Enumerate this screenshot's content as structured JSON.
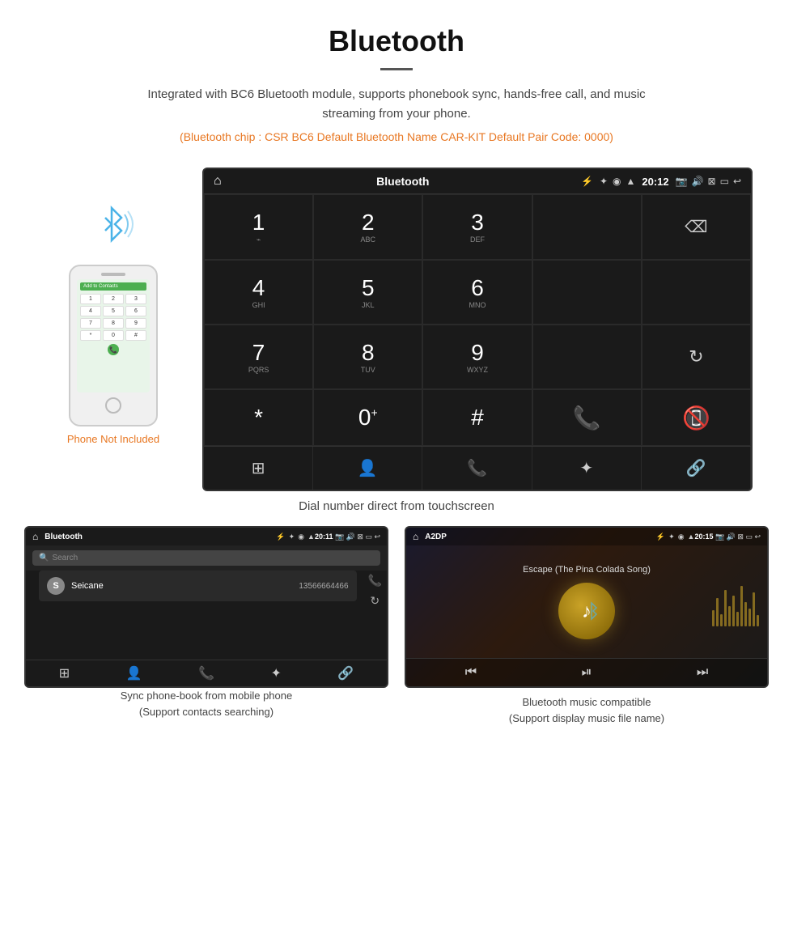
{
  "header": {
    "title": "Bluetooth",
    "description": "Integrated with BC6 Bluetooth module, supports phonebook sync, hands-free call, and music streaming from your phone.",
    "specs": "(Bluetooth chip : CSR BC6    Default Bluetooth Name CAR-KIT    Default Pair Code: 0000)"
  },
  "phone": {
    "not_included_label": "Phone Not Included",
    "screen_header": "Add to Contacts",
    "keys": [
      "1",
      "2",
      "3",
      "4",
      "5",
      "6",
      "7",
      "8",
      "9",
      "*",
      "0",
      "#"
    ]
  },
  "car_screen": {
    "title": "Bluetooth",
    "time": "20:12",
    "usb_icon": "⌨",
    "dialpad_keys": [
      {
        "main": "1",
        "sub": ""
      },
      {
        "main": "2",
        "sub": "ABC"
      },
      {
        "main": "3",
        "sub": "DEF"
      },
      {
        "main": "4",
        "sub": "GHI"
      },
      {
        "main": "5",
        "sub": "JKL"
      },
      {
        "main": "6",
        "sub": "MNO"
      },
      {
        "main": "7",
        "sub": "PQRS"
      },
      {
        "main": "8",
        "sub": "TUV"
      },
      {
        "main": "9",
        "sub": "WXYZ"
      },
      {
        "main": "*",
        "sub": ""
      },
      {
        "main": "0",
        "sub": "+"
      },
      {
        "main": "#",
        "sub": ""
      }
    ]
  },
  "main_caption": "Dial number direct from touchscreen",
  "phonebook_screen": {
    "title": "Bluetooth",
    "time": "20:11",
    "search_placeholder": "Search",
    "contact": {
      "letter": "S",
      "name": "Seicane",
      "number": "13566664466"
    }
  },
  "music_screen": {
    "title": "A2DP",
    "time": "20:15",
    "song_title": "Escape (The Pina Colada Song)",
    "music_icon": "🎵"
  },
  "captions": {
    "phonebook": "Sync phone-book from mobile phone\n(Support contacts searching)",
    "phonebook_line1": "Sync phone-book from mobile phone",
    "phonebook_line2": "(Support contacts searching)",
    "music_line1": "Bluetooth music compatible",
    "music_line2": "(Support display music file name)"
  }
}
